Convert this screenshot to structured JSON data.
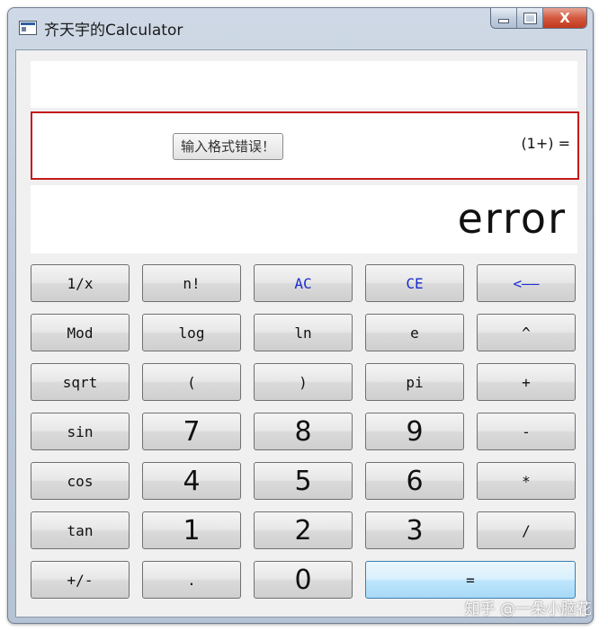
{
  "window": {
    "title": "齐天宇的Calculator",
    "controls": {
      "close_glyph": "X"
    }
  },
  "display": {
    "expression": "(1+) =",
    "error_message": "输入格式错误！",
    "result": "error"
  },
  "keys": [
    [
      "1/x",
      "n!",
      "AC",
      "CE",
      "<——"
    ],
    [
      "Mod",
      "log",
      "ln",
      "e",
      "^"
    ],
    [
      "sqrt",
      "(",
      ")",
      "pi",
      "+"
    ],
    [
      "sin",
      "7",
      "8",
      "9",
      "-"
    ],
    [
      "cos",
      "4",
      "5",
      "6",
      "*"
    ],
    [
      "tan",
      "1",
      "2",
      "3",
      "/"
    ],
    [
      "+/-",
      ".",
      "0",
      "="
    ]
  ],
  "watermark": "知乎 @一朵小脑花",
  "colors": {
    "error_border": "#c41a1a",
    "accent_text": "#1a2ccf",
    "equals_bg": "#bee6fd"
  }
}
